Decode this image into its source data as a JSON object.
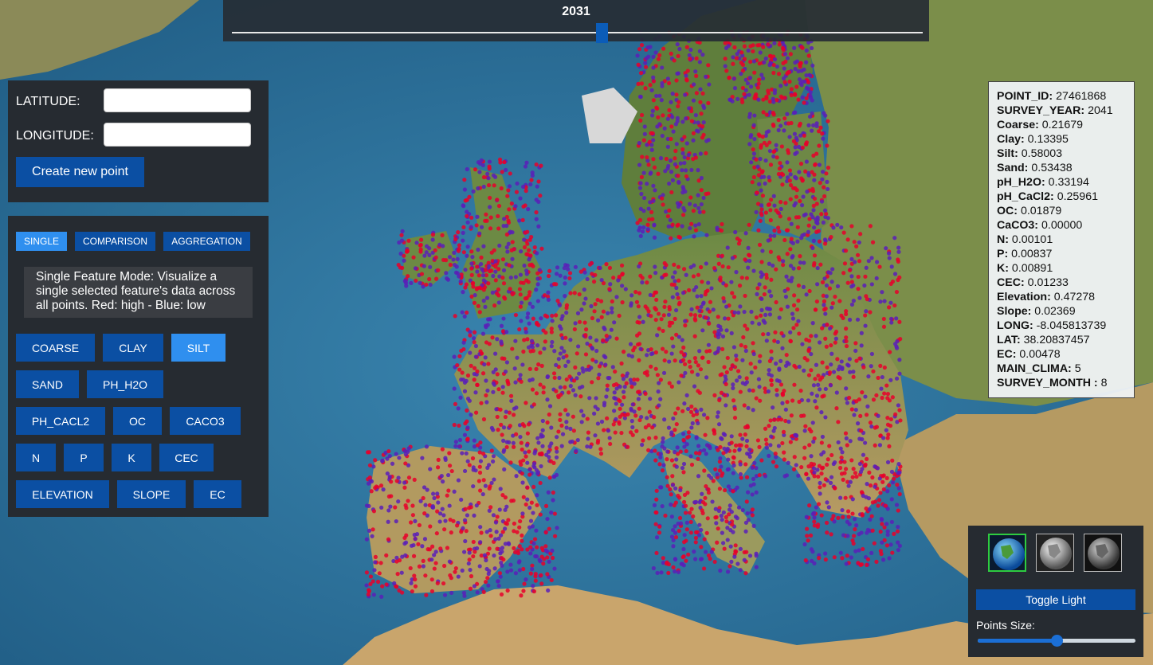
{
  "year_slider": {
    "year": "2031",
    "level": 0.535
  },
  "coords": {
    "latitude_label": "LATITUDE:",
    "longitude_label": "LONGITUDE:",
    "latitude_value": "",
    "longitude_value": "",
    "create_label": "Create new point"
  },
  "modes": [
    "SINGLE",
    "COMPARISON",
    "AGGREGATION"
  ],
  "active_mode": "SINGLE",
  "mode_description": "Single Feature Mode: Visualize a single selected feature's data across all points. Red: high - Blue: low",
  "features": [
    "COARSE",
    "CLAY",
    "SILT",
    "SAND",
    "PH_H2O",
    "PH_CACL2",
    "OC",
    "CACO3",
    "N",
    "P",
    "K",
    "CEC",
    "ELEVATION",
    "SLOPE",
    "EC"
  ],
  "active_feature": "SILT",
  "info": [
    {
      "key": "POINT_ID:",
      "value": " 27461868"
    },
    {
      "key": "SURVEY_YEAR:",
      "value": " 2041"
    },
    {
      "key": "Coarse:",
      "value": " 0.21679"
    },
    {
      "key": "Clay:",
      "value": " 0.13395"
    },
    {
      "key": "Silt:",
      "value": " 0.58003"
    },
    {
      "key": "Sand:",
      "value": " 0.53438"
    },
    {
      "key": "pH_H2O:",
      "value": " 0.33194"
    },
    {
      "key": "pH_CaCl2:",
      "value": " 0.25961"
    },
    {
      "key": "OC:",
      "value": " 0.01879"
    },
    {
      "key": "CaCO3:",
      "value": " 0.00000"
    },
    {
      "key": "N:",
      "value": " 0.00101"
    },
    {
      "key": "P:",
      "value": " 0.00837"
    },
    {
      "key": "K:",
      "value": " 0.00891"
    },
    {
      "key": "CEC:",
      "value": " 0.01233"
    },
    {
      "key": "Elevation:",
      "value": " 0.47278"
    },
    {
      "key": "Slope:",
      "value": " 0.02369"
    },
    {
      "key": "LONG:",
      "value": " -8.045813739"
    },
    {
      "key": "LAT:",
      "value": " 38.20837457"
    },
    {
      "key": "EC:",
      "value": " 0.00478"
    },
    {
      "key": "MAIN_CLIMA:",
      "value": " 5"
    },
    {
      "key": "SURVEY_MONTH :",
      "value": " 8"
    }
  ],
  "controls": {
    "toggle_label": "Toggle Light",
    "points_size_label": "Points Size:",
    "points_size_level": 0.5,
    "globe_icons": [
      "globe-color-icon",
      "globe-gray-icon",
      "globe-dark-icon"
    ],
    "selected_globe": 0
  },
  "colors": {
    "high": "#e8002a",
    "low": "#5a1fb8",
    "panel": "#262b31",
    "button": "#0b4fa3",
    "button_active": "#2f8fef"
  }
}
